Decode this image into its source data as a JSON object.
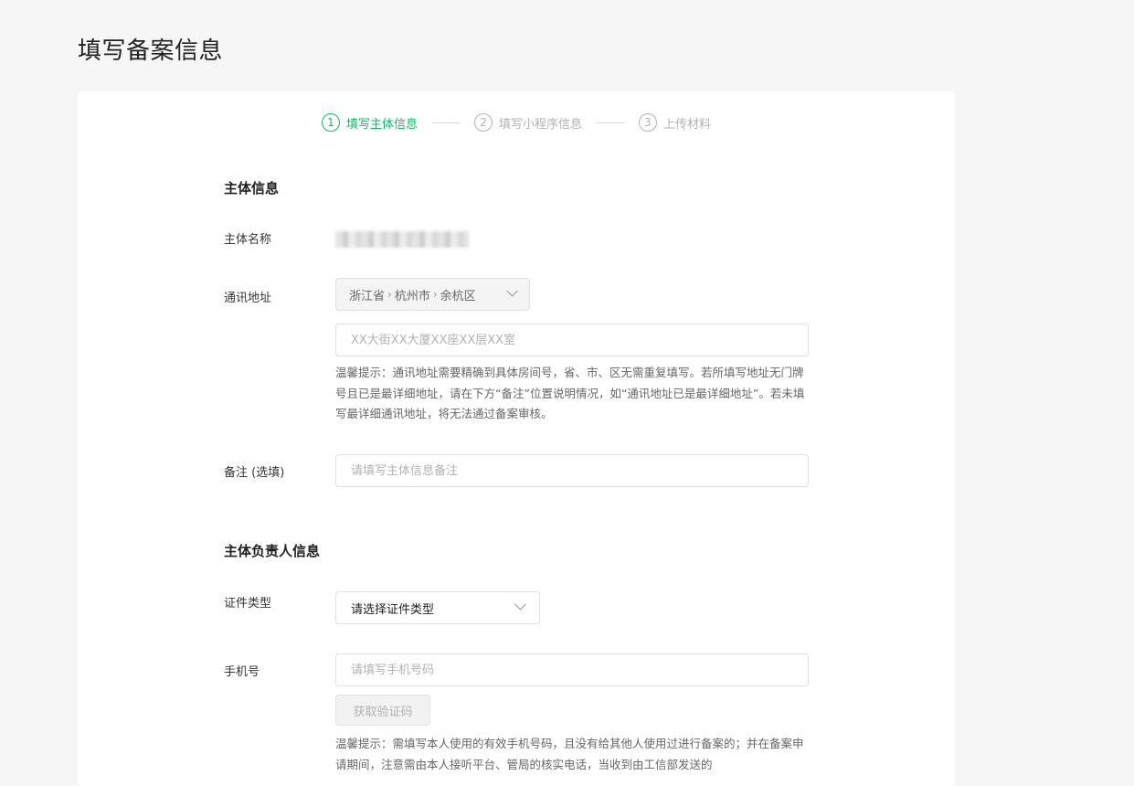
{
  "page": {
    "title": "填写备案信息"
  },
  "steps": [
    {
      "num": "1",
      "label": "填写主体信息"
    },
    {
      "num": "2",
      "label": "填写小程序信息"
    },
    {
      "num": "3",
      "label": "上传材料"
    }
  ],
  "subject_section": {
    "title": "主体信息",
    "name_label": "主体名称",
    "address_label": "通讯地址",
    "province": "浙江省",
    "city": "杭州市",
    "district": "余杭区",
    "address_placeholder": "XX大街XX大厦XX座XX层XX室",
    "address_hint": "温馨提示：通讯地址需要精确到具体房间号，省、市、区无需重复填写。若所填写地址无门牌号且已是最详细地址，请在下方“备注”位置说明情况，如“通讯地址已是最详细地址”。若未填写最详细通讯地址，将无法通过备案审核。",
    "remark_label": "备注 (选填)",
    "remark_placeholder": "请填写主体信息备注"
  },
  "principal_section": {
    "title": "主体负责人信息",
    "id_type_label": "证件类型",
    "id_type_value": "请选择证件类型",
    "phone_label": "手机号",
    "phone_placeholder": "请填写手机号码",
    "get_code_button": "获取验证码",
    "phone_hint": "温馨提示：需填写本人使用的有效手机号码，且没有给其他人使用过进行备案的；并在备案申请期间，注意需由本人接听平台、管局的核实电话，当收到由工信部发送的"
  },
  "colors": {
    "accent": "#07c160",
    "muted": "#b2b2b2"
  }
}
